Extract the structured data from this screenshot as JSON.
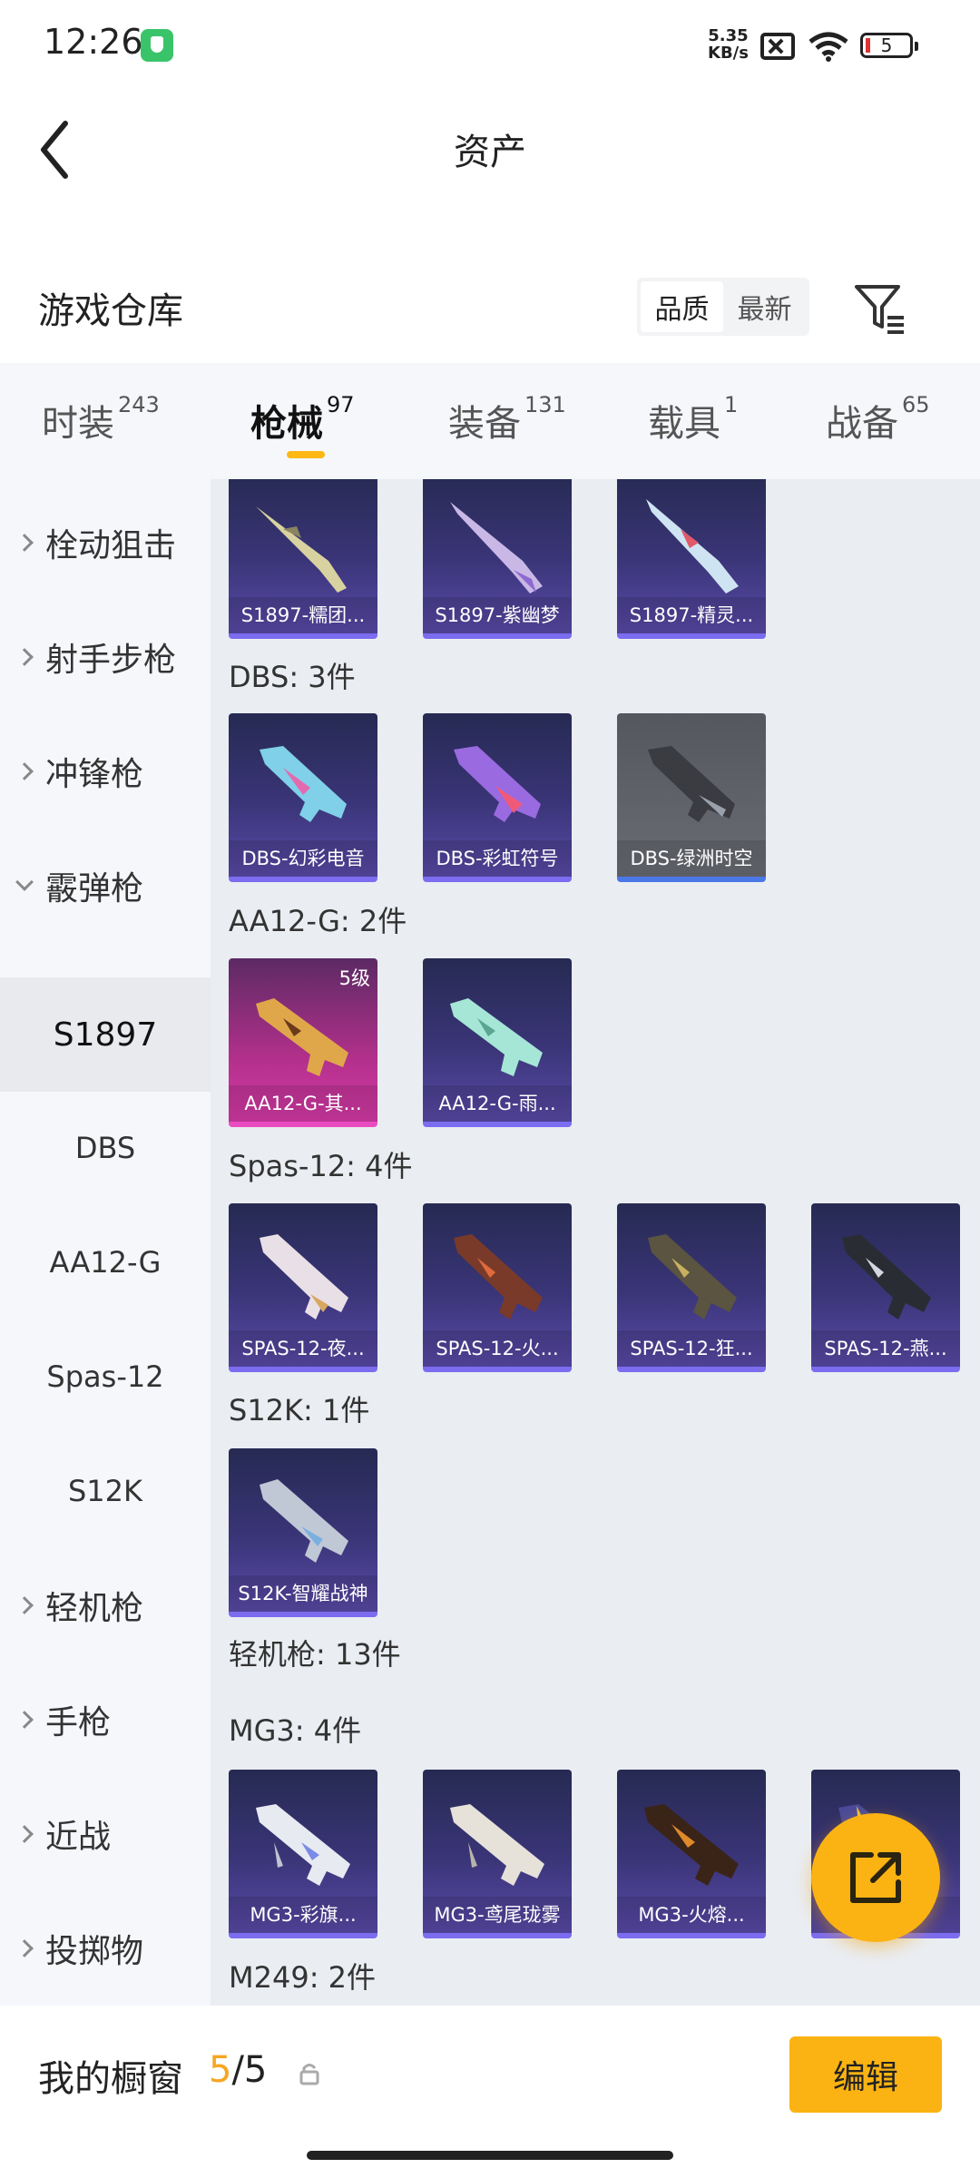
{
  "status_bar": {
    "time": "12:26",
    "speed_top": "5.35",
    "speed_bottom": "KB/s",
    "battery": "5"
  },
  "header": {
    "title": "资产"
  },
  "warehouse": {
    "title": "游戏仓库",
    "sort_options": [
      "品质",
      "最新"
    ],
    "active_sort": "品质"
  },
  "tabs": [
    {
      "label": "时装",
      "count": "243"
    },
    {
      "label": "枪械",
      "count": "97"
    },
    {
      "label": "装备",
      "count": "131"
    },
    {
      "label": "载具",
      "count": "1"
    },
    {
      "label": "战备",
      "count": "65"
    }
  ],
  "sidebar": {
    "categories": [
      "栓动狙击",
      "射手步枪",
      "冲锋枪",
      "霰弹枪",
      "轻机枪",
      "手枪",
      "近战",
      "投掷物"
    ],
    "subcategories": [
      "S1897",
      "DBS",
      "AA12-G",
      "Spas-12",
      "S12K"
    ]
  },
  "groups": [
    {
      "title": "",
      "items": [
        "S1897-糯团...",
        "S1897-紫幽梦",
        "S1897-精灵..."
      ]
    },
    {
      "title": "DBS: 3件",
      "items": [
        "DBS-幻彩电音",
        "DBS-彩虹符号",
        "DBS-绿洲时空"
      ]
    },
    {
      "title": "AA12-G: 2件",
      "items": [
        "AA12-G-其...",
        "AA12-G-雨..."
      ],
      "badge": "5级"
    },
    {
      "title": "Spas-12: 4件",
      "items": [
        "SPAS-12-夜...",
        "SPAS-12-火...",
        "SPAS-12-狂...",
        "SPAS-12-燕..."
      ]
    },
    {
      "title": "S12K: 1件",
      "items": [
        "S12K-智耀战神"
      ]
    },
    {
      "title": "轻机枪: 13件",
      "items": []
    },
    {
      "title": "MG3: 4件",
      "items": [
        "MG3-彩旗...",
        "MG3-鸢尾珑雾",
        "MG3-火熔...",
        "MG3-..."
      ]
    },
    {
      "title": "M249: 2件",
      "items": []
    }
  ],
  "bottom_bar": {
    "title": "我的橱窗",
    "current": "5",
    "total": "/5",
    "edit_label": "编辑"
  },
  "colors": {
    "accent": "#fbb313",
    "card_epic": "#3a3578",
    "card_legend": "#b0308a"
  }
}
